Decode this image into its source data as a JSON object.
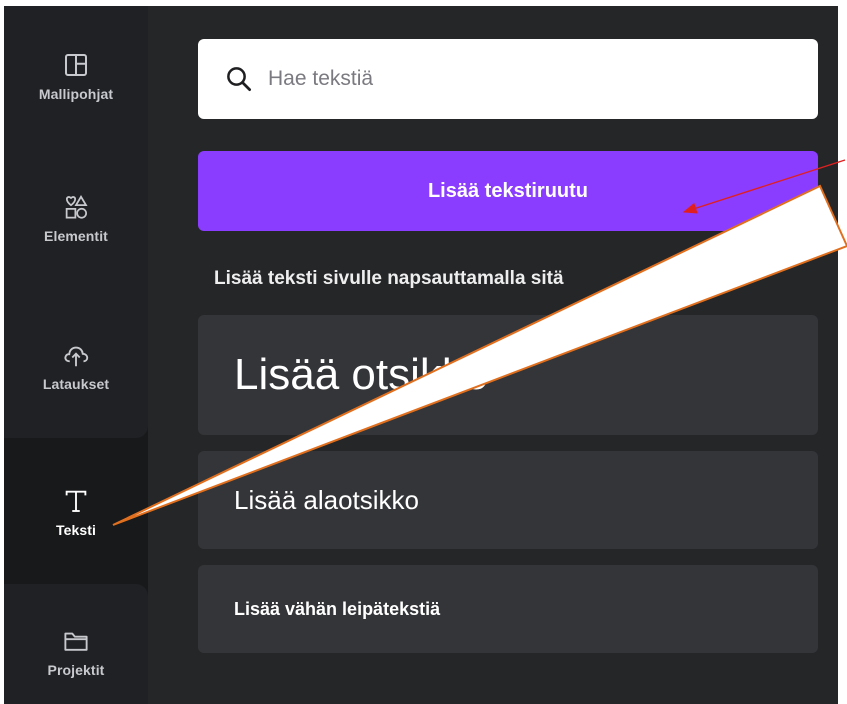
{
  "colors": {
    "sidebar_bg": "#202124",
    "panel_bg": "#252628",
    "accent": "#8b3dff",
    "card_bg": "#343538",
    "callout_stroke": "#e0701f",
    "arrow_red": "#e02020"
  },
  "sidebar": {
    "items": [
      {
        "label": "Mallipohjat",
        "icon": "layout-template-icon"
      },
      {
        "label": "Elementit",
        "icon": "shapes-icon"
      },
      {
        "label": "Lataukset",
        "icon": "cloud-upload-icon"
      },
      {
        "label": "Teksti",
        "icon": "text-t-icon",
        "active": true
      },
      {
        "label": "Projektit",
        "icon": "folder-icon"
      }
    ]
  },
  "panel": {
    "search": {
      "placeholder": "Hae tekstiä",
      "value": "",
      "icon": "search-icon"
    },
    "add_textbox_label": "Lisää tekstiruutu",
    "hint": "Lisää teksti sivulle napsauttamalla sitä",
    "cards": {
      "heading": "Lisää otsikko",
      "subheading": "Lisää alaotsikko",
      "body": "Lisää vähän leipätekstiä"
    }
  }
}
